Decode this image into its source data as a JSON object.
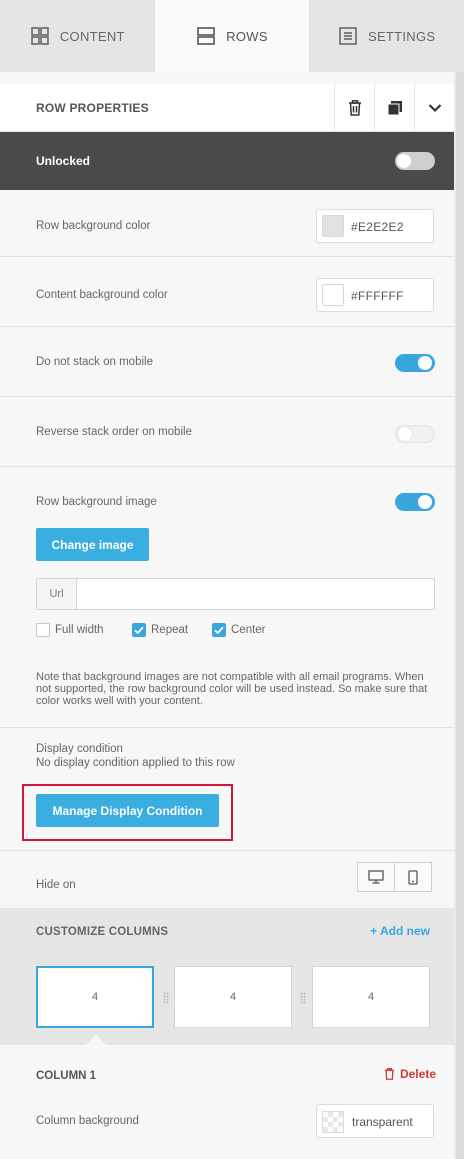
{
  "tabs": [
    {
      "label": "CONTENT",
      "icon": "grid-icon"
    },
    {
      "label": "ROWS",
      "icon": "rows-icon"
    },
    {
      "label": "SETTINGS",
      "icon": "settings-icon"
    }
  ],
  "header": {
    "title": "ROW PROPERTIES"
  },
  "lock": {
    "label": "Unlocked"
  },
  "row_bg": {
    "label": "Row background color",
    "value": "#E2E2E2",
    "swatch": "#E2E2E2"
  },
  "content_bg": {
    "label": "Content background color",
    "value": "#FFFFFF",
    "swatch": "#FFFFFF"
  },
  "stack": {
    "label": "Do not stack on mobile",
    "on": true
  },
  "reverse": {
    "label": "Reverse stack order on mobile",
    "on": false
  },
  "bg_image": {
    "label": "Row background image",
    "on": true,
    "change_label": "Change image",
    "url_prefix": "Url",
    "url_value": "",
    "options": [
      {
        "label": "Full width",
        "checked": false
      },
      {
        "label": "Repeat",
        "checked": true
      },
      {
        "label": "Center",
        "checked": true
      }
    ],
    "note": "Note that background images are not compatible with all email programs. When not supported, the row background color will be used instead. So make sure that color works well with your content."
  },
  "display_condition": {
    "title": "Display condition",
    "status": "No display condition applied to this row",
    "button": "Manage Display Condition"
  },
  "hide_on": {
    "label": "Hide on"
  },
  "columns": {
    "title": "CUSTOMIZE COLUMNS",
    "add_label": "+ Add new",
    "items": [
      "4",
      "4",
      "4"
    ]
  },
  "column": {
    "title": "COLUMN 1",
    "delete_label": "Delete",
    "bg_label": "Column background",
    "bg_value": "transparent"
  },
  "colors": {
    "accent": "#3AA6DF",
    "dark_bar": "#4A4A4A",
    "highlight": "#D4123B",
    "danger": "#D23A3A"
  }
}
